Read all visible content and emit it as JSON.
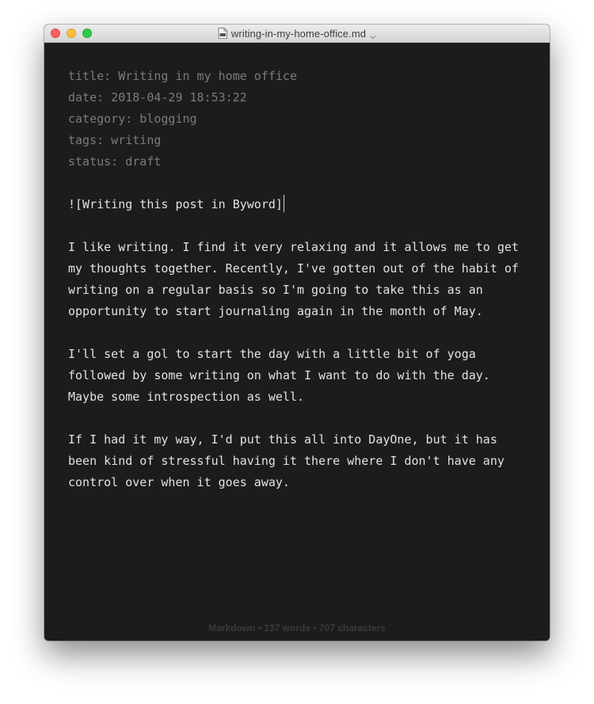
{
  "window": {
    "title": "writing-in-my-home-office.md",
    "icon": "markdown-document-icon"
  },
  "editor": {
    "front_matter": [
      "title: Writing in my home office",
      "date: 2018-04-29 18:53:22",
      "category: blogging",
      "tags: writing",
      "status: draft"
    ],
    "image_line": "![Writing this post in Byword]",
    "paragraphs": [
      [
        "I like writing. I find it very relaxing and it allows me to get",
        "my thoughts together. Recently, I've gotten out of the habit of",
        "writing on a regular basis so I'm going to take this as an",
        "opportunity to start journaling again in the month of May."
      ],
      [
        "I'll set a gol to start the day with a little bit of yoga",
        "followed by some writing on what I want to do with the day.",
        "Maybe some introspection as well."
      ],
      [
        "If I had it my way, I'd put this all into DayOne, but it has",
        "been kind of stressful having it there where I don't have any",
        "control over when it goes away."
      ]
    ]
  },
  "status_bar": {
    "text": "Markdown • 137 words • 707 characters"
  },
  "colors": {
    "editor_background": "#1c1c1c",
    "text": "#e2e2e2",
    "front_matter_text": "#7b7b7b",
    "close": "#fc605c",
    "minimize": "#fdbc40",
    "maximize": "#34c84a"
  }
}
